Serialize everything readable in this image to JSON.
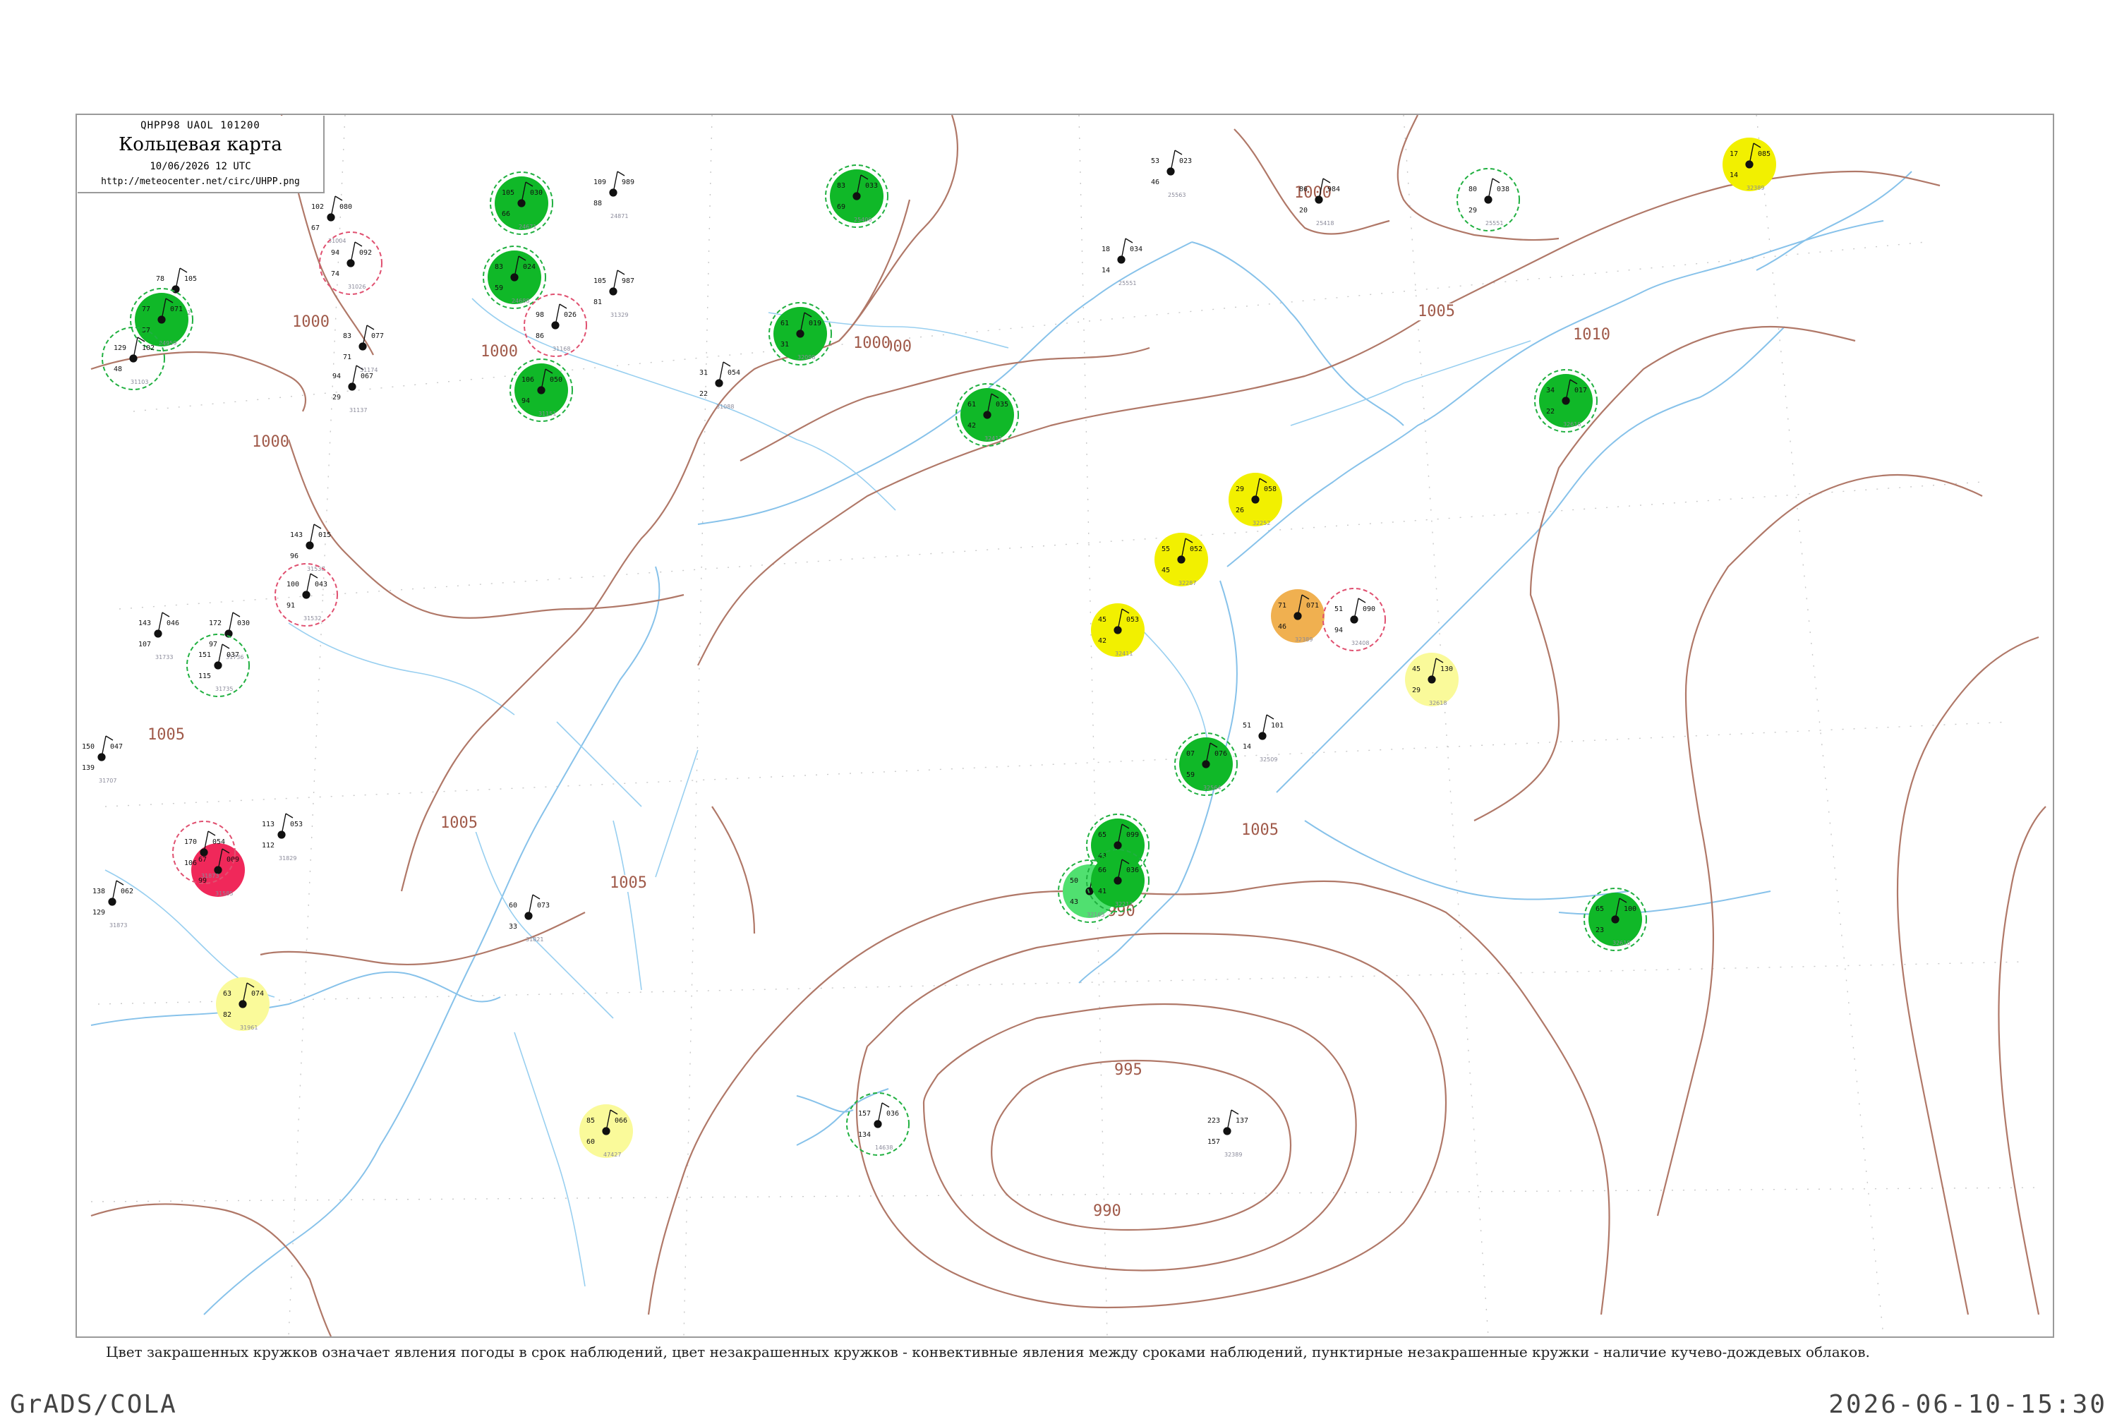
{
  "header": {
    "code": "QHPP98  UAOL  101200",
    "title": "Кольцевая карта",
    "date": "10/06/2026 12 UTC",
    "url": "http://meteocenter.net/circ/UHPP.png"
  },
  "caption": "Цвет закрашенных кружков означает явления погоды в срок наблюдений, цвет незакрашенных кружков - конвективные явления между сроками наблюдений, пунктирные незакрашенные кружки - наличие кучево-дождевых облаков.",
  "footer": {
    "left": "GrADS/COLA",
    "right": "2026-06-10-15:30"
  },
  "colors": {
    "coast": "#87c2ea",
    "isobar": "#b07868",
    "grid": "#c8c8c8",
    "green": "#10b828",
    "lightgreen": "#50e070",
    "yellow": "#f2f000",
    "lightyellow": "#fafa9a",
    "orange": "#f0b050",
    "red": "#f0285a",
    "ring_green": "#20b040",
    "ring_red": "#e05070"
  },
  "isobar_labels": [
    "1000",
    "1000",
    "1000",
    "1000",
    "1000",
    "1000",
    "1005",
    "1005",
    "1005",
    "1005",
    "1005",
    "1010",
    "990",
    "995",
    "990"
  ],
  "stations": [
    {
      "id": "24671",
      "t": "105",
      "p": "030",
      "td": "66",
      "cls": "green"
    },
    {
      "id": "24688",
      "t": "83",
      "p": "024",
      "td": "59",
      "cls": "green"
    },
    {
      "id": "31004",
      "t": "102",
      "p": "080",
      "td": "67",
      "cls": "none"
    },
    {
      "id": "31026",
      "t": "94",
      "p": "092",
      "td": "74",
      "cls": "none"
    },
    {
      "id": "31062",
      "t": "78",
      "p": "105",
      "td": "46",
      "cls": "none"
    },
    {
      "id": "24959",
      "t": "77",
      "p": "071",
      "td": "57",
      "cls": "green"
    },
    {
      "id": "31103",
      "t": "129",
      "p": "102",
      "td": "48",
      "cls": "none"
    },
    {
      "id": "31137",
      "t": "94",
      "p": "067",
      "td": "29",
      "cls": "none"
    },
    {
      "id": "31151",
      "t": "106",
      "p": "050",
      "td": "94",
      "cls": "green"
    },
    {
      "id": "31168",
      "t": "98",
      "p": "026",
      "td": "86",
      "cls": "none"
    },
    {
      "id": "31174",
      "t": "83",
      "p": "077",
      "td": "71",
      "cls": "none"
    },
    {
      "id": "31088",
      "t": "31",
      "p": "054",
      "td": "22",
      "cls": "none"
    },
    {
      "id": "32098",
      "t": "61",
      "p": "019",
      "td": "31",
      "cls": "green"
    },
    {
      "id": "24871",
      "t": "109",
      "p": "989",
      "td": "88",
      "cls": "none"
    },
    {
      "id": "31329",
      "t": "105",
      "p": "987",
      "td": "81",
      "cls": "none"
    },
    {
      "id": "25400",
      "t": "83",
      "p": "033",
      "td": "69",
      "cls": "green"
    },
    {
      "id": "25563",
      "t": "53",
      "p": "023",
      "td": "46",
      "cls": "none"
    },
    {
      "id": "25418",
      "t": "86",
      "p": "984",
      "td": "20",
      "cls": "none"
    },
    {
      "id": "25551",
      "t": "80",
      "p": "038",
      "td": "29",
      "cls": "none"
    },
    {
      "id": "25551b",
      "t": "18",
      "p": "034",
      "td": "14",
      "cls": "none"
    },
    {
      "id": "32389",
      "t": "17",
      "p": "085",
      "td": "14",
      "cls": "yellow"
    },
    {
      "id": "32411",
      "t": "61",
      "p": "035",
      "td": "42",
      "cls": "green"
    },
    {
      "id": "32618",
      "t": "34",
      "p": "017",
      "td": "22",
      "cls": "green"
    },
    {
      "id": "32252",
      "t": "29",
      "p": "058",
      "td": "26",
      "cls": "yellow"
    },
    {
      "id": "32287",
      "t": "55",
      "p": "052",
      "td": "45",
      "cls": "yellow"
    },
    {
      "id": "32389b",
      "t": "71",
      "p": "071",
      "td": "46",
      "cls": "orange"
    },
    {
      "id": "32411b",
      "t": "45",
      "p": "053",
      "td": "42",
      "cls": "yellow"
    },
    {
      "id": "32408",
      "t": "51",
      "p": "090",
      "td": "94",
      "cls": "none"
    },
    {
      "id": "32618b",
      "t": "45",
      "p": "130",
      "td": "29",
      "cls": "lightyellow"
    },
    {
      "id": "32509",
      "t": "51",
      "p": "101",
      "td": "14",
      "cls": "none"
    },
    {
      "id": "32564",
      "t": "07",
      "p": "076",
      "td": "59",
      "cls": "green"
    },
    {
      "id": "32061",
      "t": "65",
      "p": "099",
      "td": "43",
      "cls": "green"
    },
    {
      "id": "32165",
      "t": "50",
      "p": "066",
      "td": "43",
      "cls": "lightgreen"
    },
    {
      "id": "32217",
      "t": "66",
      "p": "036",
      "td": "41",
      "cls": "green"
    },
    {
      "id": "32618c",
      "t": "65",
      "p": "100",
      "td": "23",
      "cls": "green"
    },
    {
      "id": "31585",
      "t": "67",
      "p": "009",
      "td": "99",
      "cls": "red"
    },
    {
      "id": "31961",
      "t": "63",
      "p": "074",
      "td": "82",
      "cls": "lightyellow"
    },
    {
      "id": "47427",
      "t": "85",
      "p": "066",
      "td": "60",
      "cls": "lightyellow"
    },
    {
      "id": "31538",
      "t": "143",
      "p": "015",
      "td": "96",
      "cls": "none"
    },
    {
      "id": "31532",
      "t": "100",
      "p": "043",
      "td": "91",
      "cls": "none"
    },
    {
      "id": "31733",
      "t": "143",
      "p": "046",
      "td": "107",
      "cls": "none"
    },
    {
      "id": "31736",
      "t": "172",
      "p": "030",
      "td": "97",
      "cls": "none"
    },
    {
      "id": "31735",
      "t": "151",
      "p": "037",
      "td": "115",
      "cls": "none"
    },
    {
      "id": "31707",
      "t": "150",
      "p": "047",
      "td": "139",
      "cls": "none"
    },
    {
      "id": "31829",
      "t": "113",
      "p": "053",
      "td": "112",
      "cls": "none"
    },
    {
      "id": "31873",
      "t": "170",
      "p": "054",
      "td": "106",
      "cls": "none"
    },
    {
      "id": "31821",
      "t": "60",
      "p": "073",
      "td": "33",
      "cls": "none"
    },
    {
      "id": "31873b",
      "t": "138",
      "p": "062",
      "td": "129",
      "cls": "none"
    },
    {
      "id": "14638",
      "t": "157",
      "p": "036",
      "td": "134",
      "cls": "none"
    },
    {
      "id": "32389c",
      "t": "223",
      "p": "137",
      "td": "157",
      "cls": "none"
    }
  ]
}
